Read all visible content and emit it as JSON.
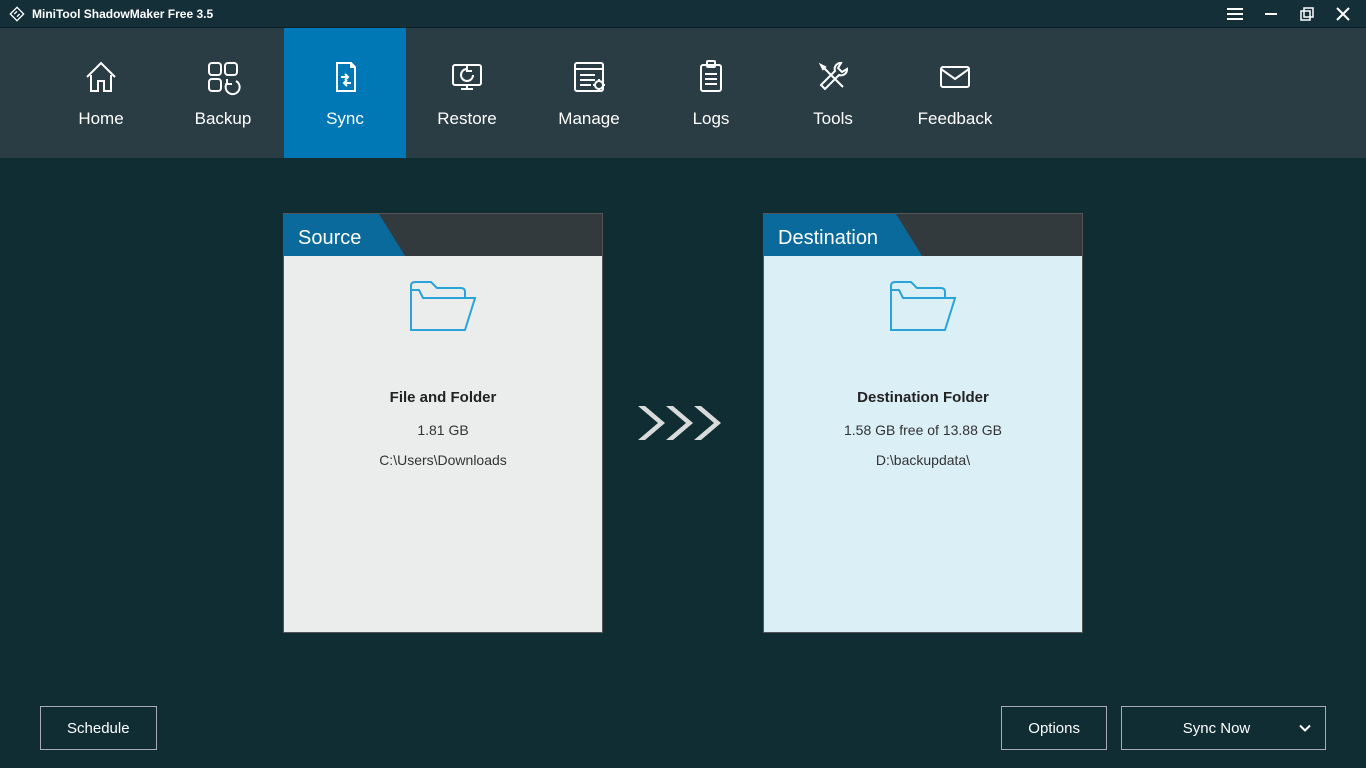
{
  "app": {
    "title": "MiniTool ShadowMaker Free 3.5"
  },
  "nav": {
    "items": [
      {
        "label": "Home"
      },
      {
        "label": "Backup"
      },
      {
        "label": "Sync"
      },
      {
        "label": "Restore"
      },
      {
        "label": "Manage"
      },
      {
        "label": "Logs"
      },
      {
        "label": "Tools"
      },
      {
        "label": "Feedback"
      }
    ]
  },
  "source": {
    "header": "Source",
    "title": "File and Folder",
    "size": "1.81 GB",
    "path": "C:\\Users\\Downloads"
  },
  "destination": {
    "header": "Destination",
    "title": "Destination Folder",
    "size": "1.58 GB free of 13.88 GB",
    "path": "D:\\backupdata\\"
  },
  "footer": {
    "schedule": "Schedule",
    "options": "Options",
    "sync_now": "Sync Now"
  }
}
